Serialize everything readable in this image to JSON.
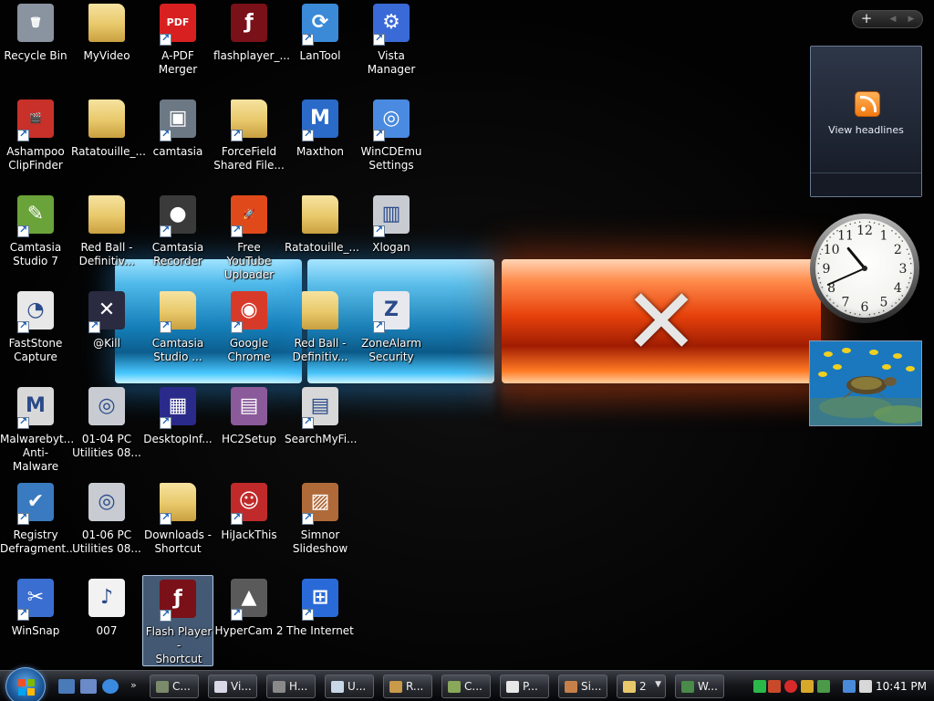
{
  "desktop": {
    "icons": [
      {
        "label": "Recycle Bin",
        "icon": "recycle-bin-icon",
        "color": "#8a93a0",
        "glyph": "🗑",
        "shortcut": false
      },
      {
        "label": "Ashampoo\nClipFinder",
        "icon": "ashampoo-icon",
        "color": "#c8302a",
        "glyph": "🎬",
        "shortcut": true
      },
      {
        "label": "Camtasia\nStudio 7",
        "icon": "camtasia-icon",
        "color": "#6aa33a",
        "glyph": "✎",
        "shortcut": true
      },
      {
        "label": "FastStone\nCapture",
        "icon": "faststone-icon",
        "color": "#e8e8e8",
        "glyph": "◔",
        "shortcut": true
      },
      {
        "label": "Malwarebyt...\nAnti-Malware",
        "icon": "malwarebytes-icon",
        "color": "#d8d8d8",
        "glyph": "M",
        "shortcut": true
      },
      {
        "label": "Registry\nDefragment...",
        "icon": "registry-icon",
        "color": "#3a7ac0",
        "glyph": "✔",
        "shortcut": true
      },
      {
        "label": "WinSnap",
        "icon": "winsnap-icon",
        "color": "#3a6ed0",
        "glyph": "✂",
        "shortcut": true
      },
      {
        "label": "MyVideo",
        "icon": "folder-icon",
        "color": "#e8c86a",
        "glyph": "",
        "shortcut": false
      },
      {
        "label": "Ratatouille_...",
        "icon": "folder-icon",
        "color": "#e8c86a",
        "glyph": "",
        "shortcut": false
      },
      {
        "label": "Red Ball -\nDefinitiv...",
        "icon": "folder-icon",
        "color": "#e8c86a",
        "glyph": "",
        "shortcut": false
      },
      {
        "label": "@Kill",
        "icon": "kill-icon",
        "color": "#2a2a40",
        "glyph": "✕",
        "shortcut": true
      },
      {
        "label": "01-04 PC\nUtilities 08...",
        "icon": "disc-icon",
        "color": "#c8ccd2",
        "glyph": "◎",
        "shortcut": false
      },
      {
        "label": "01-06 PC\nUtilities 08...",
        "icon": "disc-icon",
        "color": "#c8ccd2",
        "glyph": "◎",
        "shortcut": false
      },
      {
        "label": "007",
        "icon": "mp3-file-icon",
        "color": "#f2f2f2",
        "glyph": "♪",
        "shortcut": false
      },
      {
        "label": "A-PDF\nMerger",
        "icon": "pdf-icon",
        "color": "#d82020",
        "glyph": "PDF",
        "shortcut": true
      },
      {
        "label": "camtasia",
        "icon": "camtasia-app-icon",
        "color": "#6c7884",
        "glyph": "▣",
        "shortcut": true
      },
      {
        "label": "Camtasia\nRecorder",
        "icon": "camera-icon",
        "color": "#3a3a3a",
        "glyph": "●",
        "shortcut": true
      },
      {
        "label": "Camtasia\nStudio ...",
        "icon": "folder-icon",
        "color": "#e8c86a",
        "glyph": "",
        "shortcut": true
      },
      {
        "label": "DesktopInf...",
        "icon": "monitor-icon",
        "color": "#2a2a8a",
        "glyph": "▦",
        "shortcut": true
      },
      {
        "label": "Downloads -\nShortcut",
        "icon": "folder-icon",
        "color": "#e8c86a",
        "glyph": "",
        "shortcut": true
      },
      {
        "label": "Flash Player -\nShortcut",
        "icon": "flash-icon",
        "color": "#7a1018",
        "glyph": "ƒ",
        "shortcut": true
      },
      {
        "label": "flashplayer_...",
        "icon": "flash-icon",
        "color": "#7a1018",
        "glyph": "ƒ",
        "shortcut": false
      },
      {
        "label": "ForceField\nShared File...",
        "icon": "folder-icon",
        "color": "#e8c86a",
        "glyph": "",
        "shortcut": true
      },
      {
        "label": "Free YouTube\nUploader",
        "icon": "rocket-icon",
        "color": "#e04a1a",
        "glyph": "🚀",
        "shortcut": true
      },
      {
        "label": "Google\nChrome",
        "icon": "chrome-icon",
        "color": "#d83a2a",
        "glyph": "◉",
        "shortcut": true
      },
      {
        "label": "HC2Setup",
        "icon": "setup-box-icon",
        "color": "#8a5a9a",
        "glyph": "▤",
        "shortcut": false
      },
      {
        "label": "HiJackThis",
        "icon": "hijackthis-icon",
        "color": "#c02a2a",
        "glyph": "☺",
        "shortcut": true
      },
      {
        "label": "HyperCam 2",
        "icon": "hypercam-icon",
        "color": "#5a5a5a",
        "glyph": "▲",
        "shortcut": true
      },
      {
        "label": "LanTool",
        "icon": "lantool-icon",
        "color": "#3a8ad8",
        "glyph": "⟳",
        "shortcut": true
      },
      {
        "label": "Maxthon",
        "icon": "maxthon-icon",
        "color": "#2a6ac8",
        "glyph": "M",
        "shortcut": true
      },
      {
        "label": "Ratatouille_...",
        "icon": "zip-folder-icon",
        "color": "#e8c86a",
        "glyph": "",
        "shortcut": false
      },
      {
        "label": "Red Ball -\nDefinitiv...",
        "icon": "zip-folder-icon",
        "color": "#e8c86a",
        "glyph": "",
        "shortcut": false
      },
      {
        "label": "SearchMyFi...",
        "icon": "searchmyfiles-icon",
        "color": "#d8d8d8",
        "glyph": "▤",
        "shortcut": true
      },
      {
        "label": "Simnor\nSlideshow",
        "icon": "simnor-icon",
        "color": "#b06a3a",
        "glyph": "▨",
        "shortcut": true
      },
      {
        "label": "The Internet",
        "icon": "network-icon",
        "color": "#2a6ad8",
        "glyph": "⊞",
        "shortcut": true
      },
      {
        "label": "Vista\nManager",
        "icon": "vista-manager-icon",
        "color": "#3a6ad8",
        "glyph": "⚙",
        "shortcut": true
      },
      {
        "label": "WinCDEmu\nSettings",
        "icon": "wincdemu-icon",
        "color": "#4a8ae0",
        "glyph": "◎",
        "shortcut": true
      },
      {
        "label": "Xlogan",
        "icon": "xlogan-icon",
        "color": "#c8ccd2",
        "glyph": "▥",
        "shortcut": true
      },
      {
        "label": "ZoneAlarm\nSecurity",
        "icon": "zonealarm-icon",
        "color": "#e8e8ef",
        "glyph": "Z",
        "shortcut": true
      }
    ]
  },
  "flash_artwork": {
    "close_glyph": "✕"
  },
  "sidebar": {
    "add_glyph": "+",
    "prev_glyph": "◀",
    "next_glyph": "▶",
    "feed_label": "View headlines",
    "clock": {
      "hour": 10,
      "minute": 41,
      "numerals": [
        "12",
        "1",
        "2",
        "3",
        "4",
        "5",
        "6",
        "7",
        "8",
        "9",
        "10",
        "11"
      ]
    }
  },
  "taskbar": {
    "quick_launch": [
      {
        "icon": "show-desktop-icon",
        "color": "#4a7ab8"
      },
      {
        "icon": "switch-windows-icon",
        "color": "#6a8ac8"
      },
      {
        "icon": "internet-explorer-icon",
        "color": "#3a8ae0"
      }
    ],
    "quick_launch_more": "»",
    "tasks": [
      {
        "label": "C...",
        "icon": "camtasia-task-icon",
        "color": "#7a8a6a",
        "caret": ""
      },
      {
        "label": "Vi...",
        "icon": "document-task-icon",
        "color": "#d8d8e8",
        "caret": ""
      },
      {
        "label": "H...",
        "icon": "hypercam-task-icon",
        "color": "#8a8a8a",
        "caret": ""
      },
      {
        "label": "U...",
        "icon": "notepad-task-icon",
        "color": "#c8d8e8",
        "caret": ""
      },
      {
        "label": "R...",
        "icon": "registry-task-icon",
        "color": "#c89a4a",
        "caret": ""
      },
      {
        "label": "C...",
        "icon": "camtasia-studio-task-icon",
        "color": "#8aa85a",
        "caret": ""
      },
      {
        "label": "P...",
        "icon": "paint-task-icon",
        "color": "#e8e8e8",
        "caret": ""
      },
      {
        "label": "Si...",
        "icon": "simnor-task-icon",
        "color": "#c8804a",
        "caret": ""
      },
      {
        "label": "2",
        "icon": "folder-task-icon",
        "color": "#e8c86a",
        "caret": "▼"
      },
      {
        "label": "W...",
        "icon": "winsnap-task-icon",
        "color": "#4a8a4a",
        "caret": ""
      }
    ],
    "tray": [
      {
        "icon": "battery-icon",
        "color": "#2ab84a"
      },
      {
        "icon": "tools-tray-icon",
        "color": "#c84a2a"
      },
      {
        "icon": "blocked-tray-icon",
        "color": "#d82a2a"
      },
      {
        "icon": "shield-tray-icon",
        "color": "#d8a82a"
      },
      {
        "icon": "security-tray-icon",
        "color": "#4a9a4a"
      },
      {
        "icon": "network-tray-icon",
        "color": "#4a8ad8"
      },
      {
        "icon": "volume-muted-icon",
        "color": "#d8d8d8"
      }
    ],
    "clock": "10:41 PM"
  }
}
